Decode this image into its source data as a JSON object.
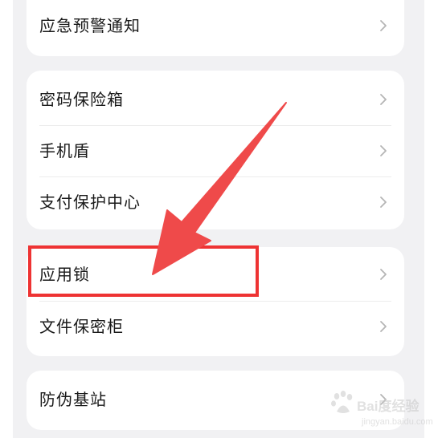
{
  "settings": {
    "cards": [
      {
        "rows": [
          {
            "label": "应急预警通知"
          }
        ]
      },
      {
        "rows": [
          {
            "label": "密码保险箱"
          },
          {
            "label": "手机盾"
          },
          {
            "label": "支付保护中心"
          }
        ]
      },
      {
        "rows": [
          {
            "label": "应用锁"
          },
          {
            "label": "文件保密柜"
          }
        ]
      },
      {
        "rows": [
          {
            "label": "防伪基站"
          }
        ]
      }
    ]
  },
  "annotation": {
    "highlight_color": "#ee3333",
    "arrow_color": "#ef4a4a",
    "highlighted_item": "应用锁"
  },
  "watermark": {
    "text": "Bai度经验",
    "url": "jingyan.baidu.com"
  }
}
